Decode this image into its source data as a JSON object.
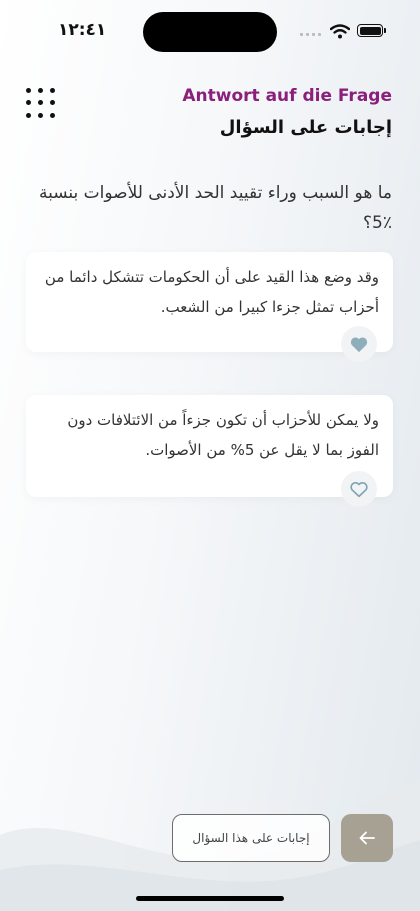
{
  "status_bar": {
    "time": "١٢:٤١"
  },
  "header": {
    "subtitle": "Antwort auf die Frage",
    "title": "إجابات على السؤال"
  },
  "question": "ما هو السبب وراء تقييد الحد الأدنى للأصوات بنسبة ٪5؟",
  "answers": [
    {
      "text": "وقد وضع هذا القيد على أن الحكومات تتشكل دائما من أحزاب تمثل جزءا كبيرا من الشعب.",
      "liked": true
    },
    {
      "text": "ولا يمكن للأحزاب أن تكون جزءاً من الائتلافات دون الفوز بما لا يقل عن 5% من الأصوات.",
      "liked": false
    }
  ],
  "footer": {
    "answers_button": "إجابات على هذا السؤال"
  },
  "icons": {
    "menu": "grid-icon",
    "like": "heart-icon",
    "back": "arrow-left-icon"
  },
  "colors": {
    "accent": "#8a1f7c",
    "button_fill": "#a7a193",
    "heart_filled": "#8eaebb",
    "heart_outline": "#7fa3b3"
  }
}
